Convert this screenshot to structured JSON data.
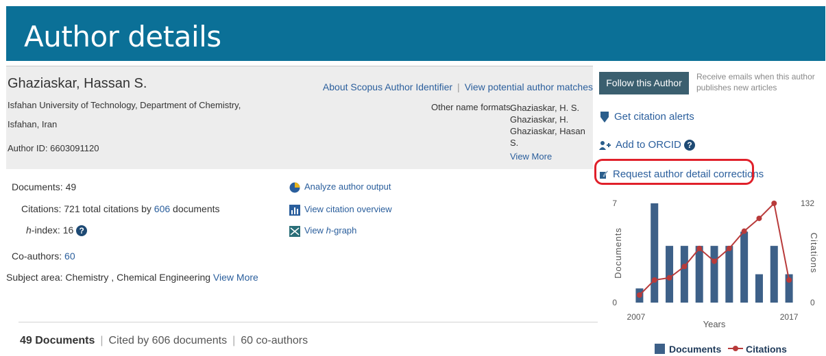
{
  "header": {
    "title": "Author details"
  },
  "author": {
    "name": "Ghaziaskar, Hassan S.",
    "affiliation_line1": "Isfahan University of Technology, Department of Chemistry,",
    "affiliation_line2": "Isfahan, Iran",
    "author_id": "Author ID: 6603091120"
  },
  "top_links": {
    "about": "About Scopus Author Identifier",
    "separator": "|",
    "matches": "View potential author matches"
  },
  "other_names": {
    "label": "Other name formats:",
    "items": [
      "Ghaziaskar, H. S.",
      "Ghaziaskar, H.",
      "Ghaziaskar, Hasan S."
    ],
    "view_more": "View More"
  },
  "stats": {
    "documents_label": "Documents:",
    "documents_value": "49",
    "citations_label": "Citations:",
    "citations_pre": "721 total citations by",
    "citations_link": "606",
    "citations_post": "documents",
    "hindex_label": "-index:",
    "hindex_h": "h",
    "hindex_value": "16",
    "help": "?",
    "coauthors_label": "Co-authors:",
    "coauthors_value": "60",
    "subject_label": "Subject area:",
    "subject_value": "Chemistry ,  Chemical Engineering",
    "subject_more": "View More"
  },
  "tools": {
    "analyze": "Analyze author output",
    "citation_overview": "View citation overview",
    "hgraph_pre": "View",
    "hgraph_h": "h",
    "hgraph_post": "-graph"
  },
  "bottom_bar": {
    "documents": "49 Documents",
    "cited_by": "Cited by 606 documents",
    "coauthors": "60 co-authors",
    "separator": "|"
  },
  "sidebar": {
    "follow_button": "Follow this Author",
    "follow_note": "Receive emails when this author publishes new articles",
    "citation_alerts": "Get citation alerts",
    "add_orcid": "Add to ORCID",
    "request_corrections": "Request author detail corrections",
    "highlight_color": "#e0202a"
  },
  "chart_data": {
    "type": "bar+line",
    "xlabel": "Years",
    "ylabel_left": "Documents",
    "ylabel_right": "Citations",
    "x_start_label": "2007",
    "x_end_label": "2017",
    "ylim_left": [
      0,
      7
    ],
    "ylim_right": [
      0,
      132
    ],
    "left_ticks": [
      "7",
      "0"
    ],
    "right_ticks": [
      "132",
      "0"
    ],
    "series": [
      {
        "name": "Documents",
        "type": "bar",
        "color": "#3d6088",
        "values": [
          1,
          7,
          4,
          4,
          4,
          4,
          4,
          5,
          2,
          4,
          2
        ]
      },
      {
        "name": "Citations",
        "type": "line",
        "color": "#b83a3a",
        "values": [
          10,
          30,
          33,
          48,
          72,
          55,
          72,
          95,
          112,
          132,
          30
        ]
      }
    ],
    "legend": "bottom"
  }
}
